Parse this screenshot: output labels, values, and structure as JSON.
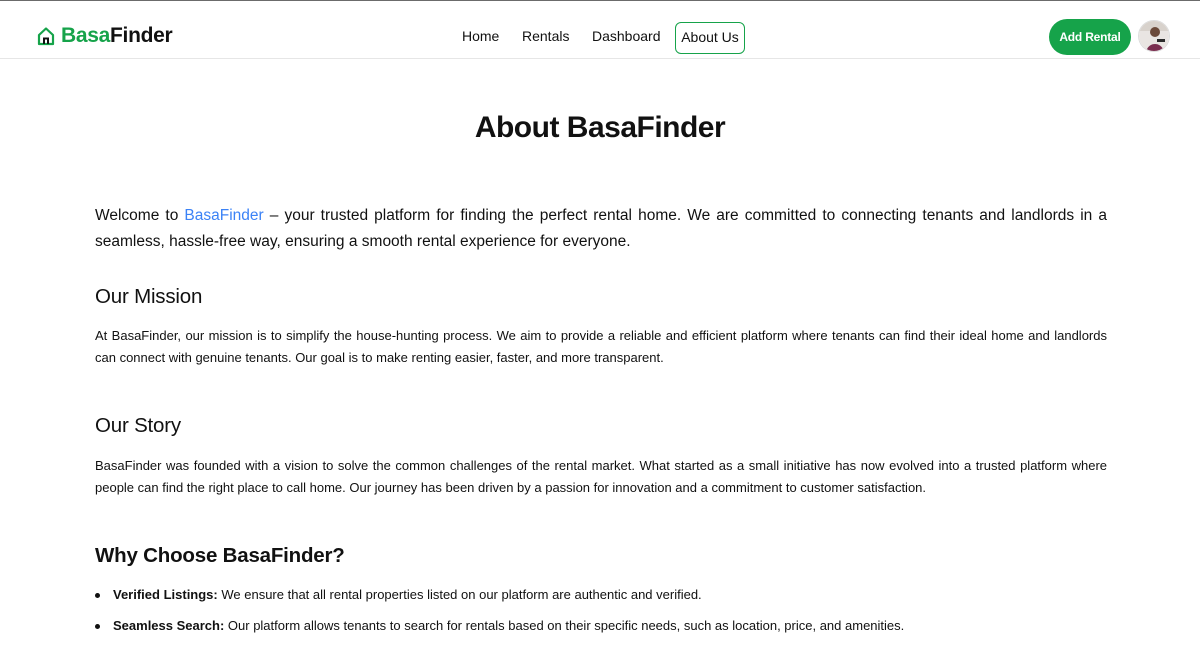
{
  "brand": {
    "part1": "Basa",
    "part2": "Finder",
    "accent": "#16a34a",
    "icon": "home-icon"
  },
  "nav": {
    "home": "Home",
    "rentals": "Rentals",
    "dashboard": "Dashboard",
    "about": "About Us"
  },
  "actions": {
    "add_rental": "Add Rental",
    "avatar": "user-avatar"
  },
  "page": {
    "title": "About BasaFinder",
    "intro": {
      "before": "Welcome to ",
      "brand": "BasaFinder",
      "after": " – your trusted platform for finding the perfect rental home. We are committed to connecting tenants and landlords in a seamless, hassle-free way, ensuring a smooth rental experience for everyone.",
      "brand_color": "#3b82f6"
    },
    "mission": {
      "heading": "Our Mission",
      "text": "At BasaFinder, our mission is to simplify the house-hunting process. We aim to provide a reliable and efficient platform where tenants can find their ideal home and landlords can connect with genuine tenants. Our goal is to make renting easier, faster, and more transparent."
    },
    "story": {
      "heading": "Our Story",
      "text": "BasaFinder was founded with a vision to solve the common challenges of the rental market. What started as a small initiative has now evolved into a trusted platform where people can find the right place to call home. Our journey has been driven by a passion for innovation and a commitment to customer satisfaction."
    },
    "why": {
      "heading": "Why Choose BasaFinder?",
      "items": [
        {
          "label": "Verified Listings:",
          "text": " We ensure that all rental properties listed on our platform are authentic and verified."
        },
        {
          "label": "Seamless Search:",
          "text": " Our platform allows tenants to search for rentals based on their specific needs, such as location, price, and amenities."
        }
      ]
    }
  }
}
